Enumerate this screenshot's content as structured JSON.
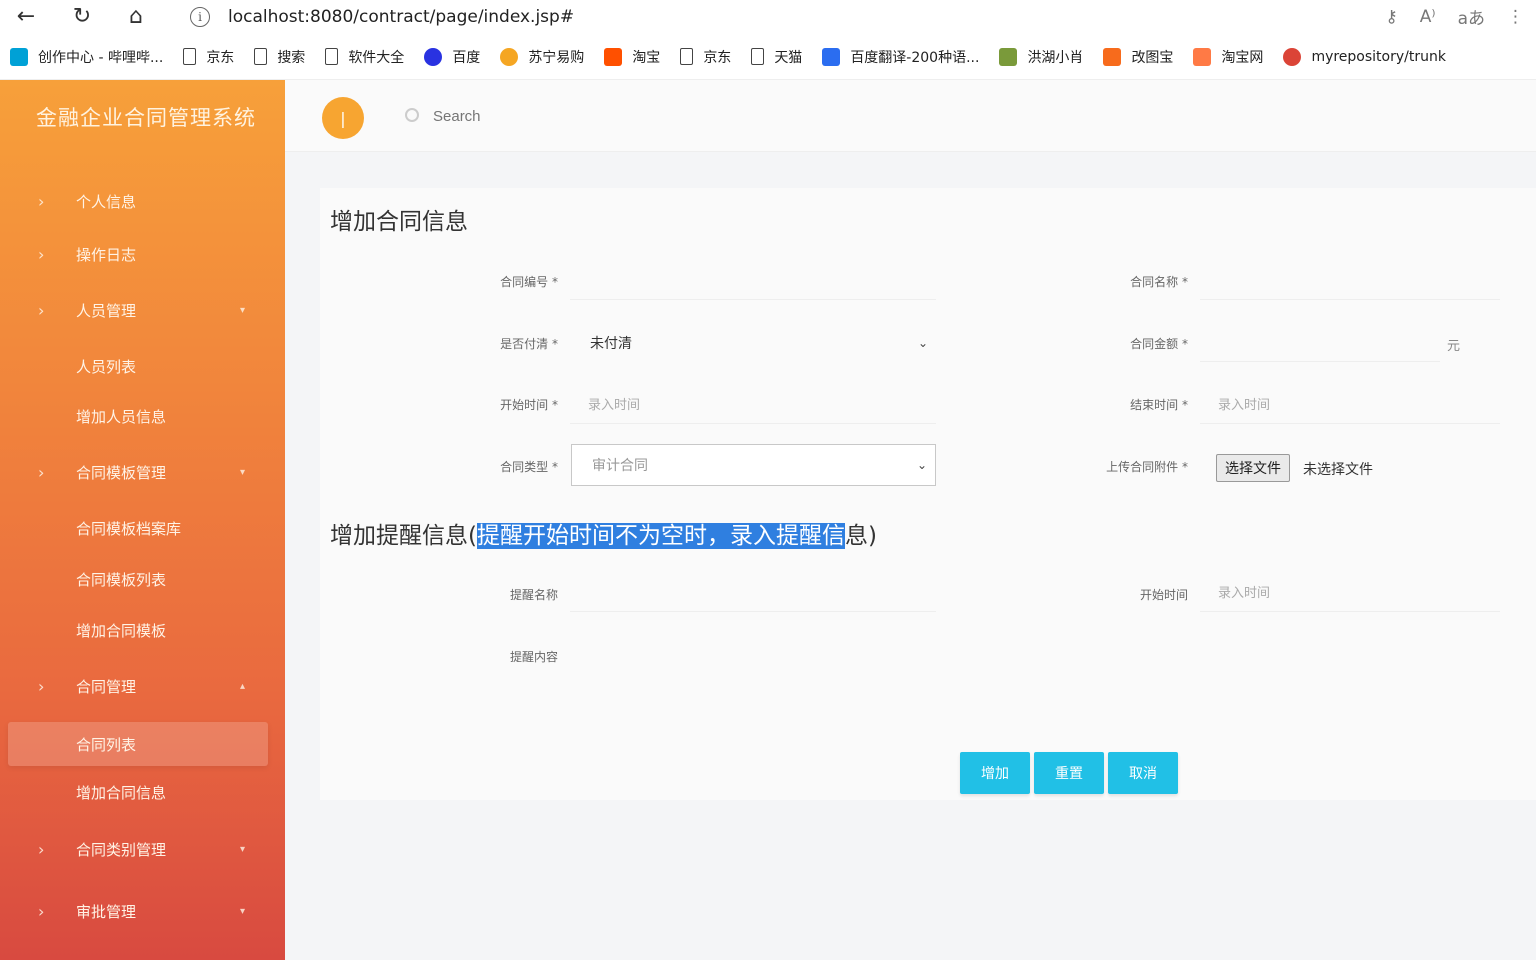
{
  "browser": {
    "url": "localhost:8080/contract/page/index.jsp#",
    "bookmarks": [
      {
        "label": "创作中心 - 哔哩哔...",
        "icon": "bilibili-icon",
        "color": "#00a1d6"
      },
      {
        "label": "京东",
        "icon": "page-icon"
      },
      {
        "label": "搜索",
        "icon": "page-icon"
      },
      {
        "label": "软件大全",
        "icon": "page-icon"
      },
      {
        "label": "百度",
        "icon": "baidu-paw-icon",
        "color": "#2932e1"
      },
      {
        "label": "苏宁易购",
        "icon": "suning-icon",
        "color": "#f5a623"
      },
      {
        "label": "淘宝",
        "icon": "taobao-icon",
        "color": "#ff5000"
      },
      {
        "label": "京东",
        "icon": "page-icon"
      },
      {
        "label": "天猫",
        "icon": "page-icon"
      },
      {
        "label": "百度翻译-200种语...",
        "icon": "translate-icon",
        "color": "#2b6df0"
      },
      {
        "label": "洪湖小肖",
        "icon": "bird-icon",
        "color": "#7a9a3a"
      },
      {
        "label": "改图宝",
        "icon": "gaitubao-icon",
        "color": "#f76b1c"
      },
      {
        "label": "淘宝网",
        "icon": "taobao-net-icon",
        "color": "#ff7a45"
      },
      {
        "label": "myrepository/trunk",
        "icon": "chrome-icon",
        "color": "#db4437"
      }
    ]
  },
  "sidebar": {
    "brand": "金融企业合同管理系统",
    "items": [
      {
        "label": "个人信息",
        "chevron": "›",
        "caret": ""
      },
      {
        "label": "操作日志",
        "chevron": "›",
        "caret": ""
      },
      {
        "label": "人员管理",
        "chevron": "›",
        "caret": "▾"
      },
      {
        "label": "人员列表",
        "chevron": "",
        "caret": ""
      },
      {
        "label": "增加人员信息",
        "chevron": "",
        "caret": ""
      },
      {
        "label": "合同模板管理",
        "chevron": "›",
        "caret": "▾"
      },
      {
        "label": "合同模板档案库",
        "chevron": "",
        "caret": ""
      },
      {
        "label": "合同模板列表",
        "chevron": "",
        "caret": ""
      },
      {
        "label": "增加合同模板",
        "chevron": "",
        "caret": ""
      },
      {
        "label": "合同管理",
        "chevron": "›",
        "caret": "▴"
      },
      {
        "label": "合同列表",
        "chevron": "",
        "caret": ""
      },
      {
        "label": "增加合同信息",
        "chevron": "",
        "caret": ""
      },
      {
        "label": "合同类别管理",
        "chevron": "›",
        "caret": "▾"
      },
      {
        "label": "审批管理",
        "chevron": "›",
        "caret": "▾"
      }
    ]
  },
  "header": {
    "toggle_label": "|",
    "search_placeholder": "Search"
  },
  "form": {
    "title": "增加合同信息",
    "contract_no_label": "合同编号 *",
    "contract_name_label": "合同名称 *",
    "paid_label": "是否付清 *",
    "paid_value": "未付清",
    "amount_label": "合同金额 *",
    "amount_unit": "元",
    "start_label": "开始时间 *",
    "start_placeholder": "录入时间",
    "end_label": "结束时间 *",
    "end_placeholder": "录入时间",
    "type_label": "合同类型 *",
    "type_value": "审计合同",
    "upload_label": "上传合同附件 *",
    "upload_button": "选择文件",
    "upload_status": "未选择文件"
  },
  "reminder": {
    "title_prefix": "增加提醒信息(",
    "title_highlight": "提醒开始时间不为空时，录入提醒信",
    "title_suffix": "息)",
    "name_label": "提醒名称",
    "start_label": "开始时间",
    "start_placeholder": "录入时间",
    "content_label": "提醒内容"
  },
  "actions": {
    "add": "增加",
    "reset": "重置",
    "cancel": "取消"
  }
}
